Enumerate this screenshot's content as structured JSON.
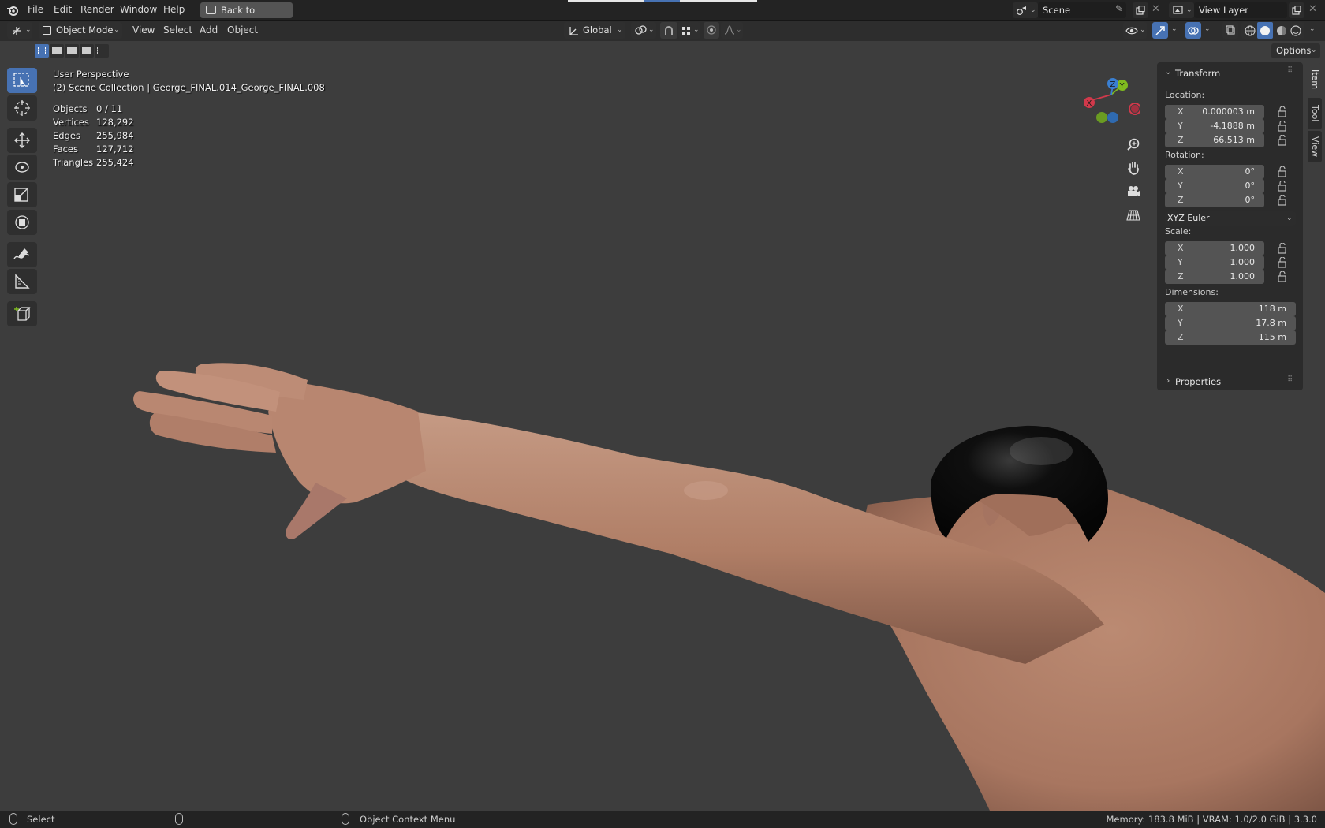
{
  "menubar": {
    "items": [
      "File",
      "Edit",
      "Render",
      "Window",
      "Help"
    ],
    "back_label": "Back to Previous",
    "scene_name": "Scene",
    "view_layer": "View Layer"
  },
  "header": {
    "mode": "Object Mode",
    "menus": [
      "View",
      "Select",
      "Add",
      "Object"
    ],
    "orientation": "Global",
    "options_label": "Options"
  },
  "viewport": {
    "perspective": "User Perspective",
    "collection": "(2) Scene Collection | George_FINAL.014_George_FINAL.008",
    "stats": [
      {
        "label": "Objects",
        "value": "0 / 11"
      },
      {
        "label": "Vertices",
        "value": "128,292"
      },
      {
        "label": "Edges",
        "value": "255,984"
      },
      {
        "label": "Faces",
        "value": "127,712"
      },
      {
        "label": "Triangles",
        "value": "255,424"
      }
    ],
    "gizmo": {
      "x": "X",
      "y": "Y",
      "z": "Z"
    }
  },
  "npanel": {
    "transform_title": "Transform",
    "location_label": "Location:",
    "location": [
      {
        "axis": "X",
        "value": "0.000003 m"
      },
      {
        "axis": "Y",
        "value": "-4.1888 m"
      },
      {
        "axis": "Z",
        "value": "66.513 m"
      }
    ],
    "rotation_label": "Rotation:",
    "rotation": [
      {
        "axis": "X",
        "value": "0°"
      },
      {
        "axis": "Y",
        "value": "0°"
      },
      {
        "axis": "Z",
        "value": "0°"
      }
    ],
    "rotation_mode": "XYZ Euler",
    "scale_label": "Scale:",
    "scale": [
      {
        "axis": "X",
        "value": "1.000"
      },
      {
        "axis": "Y",
        "value": "1.000"
      },
      {
        "axis": "Z",
        "value": "1.000"
      }
    ],
    "dimensions_label": "Dimensions:",
    "dimensions": [
      {
        "axis": "X",
        "value": "118 m"
      },
      {
        "axis": "Y",
        "value": "17.8 m"
      },
      {
        "axis": "Z",
        "value": "115 m"
      }
    ],
    "properties_title": "Properties",
    "tabs": [
      "Item",
      "Tool",
      "View"
    ]
  },
  "statusbar": {
    "select": "Select",
    "context_menu": "Object Context Menu",
    "memory": "Memory: 183.8 MiB | VRAM: 1.0/2.0 GiB | 3.3.0"
  },
  "colors": {
    "accent": "#4772b3",
    "axis_x": "#d1394b",
    "axis_y": "#7fbb1f",
    "axis_z": "#3a7fd1",
    "skin": "#b9876f",
    "hair": "#141414"
  }
}
